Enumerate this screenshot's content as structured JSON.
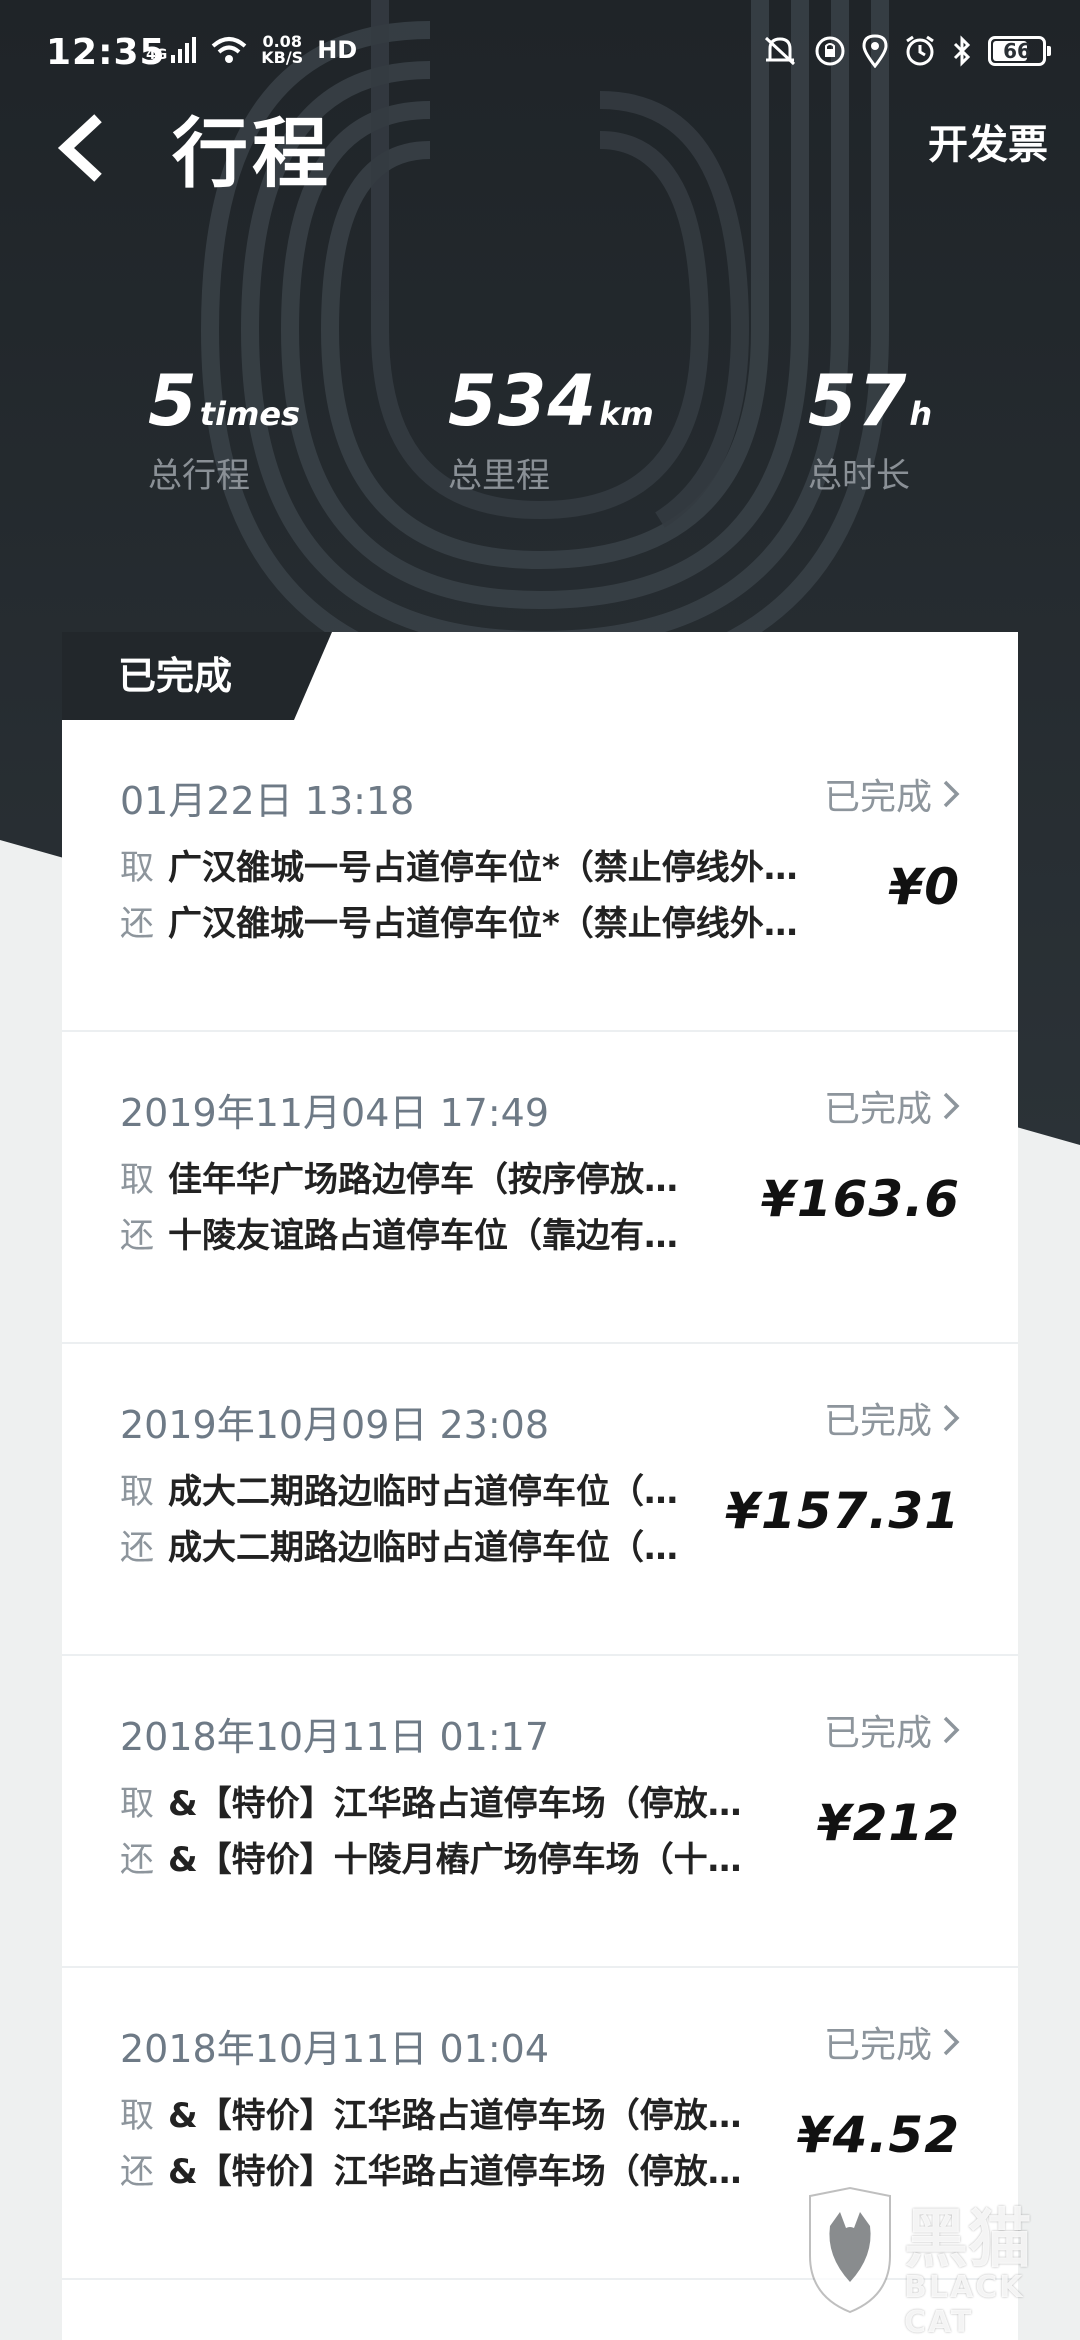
{
  "status_bar": {
    "time": "12:35",
    "network": "4G",
    "net_speed_value": "0.08",
    "net_speed_unit": "KB/S",
    "hd": "HD",
    "battery": "66"
  },
  "nav": {
    "title": "行程",
    "invoice_label": "开发票"
  },
  "stats": [
    {
      "value": "5",
      "unit": "times",
      "label": "总行程"
    },
    {
      "value": "534",
      "unit": "km",
      "label": "总里程"
    },
    {
      "value": "57",
      "unit": "h",
      "label": "总时长"
    }
  ],
  "list": {
    "tab_label": "已完成",
    "pickup_tag": "取",
    "return_tag": "还",
    "trips": [
      {
        "datetime": "01月22日 13:18",
        "status": "已完成",
        "pickup": "广汉雒城一号占道停车位*（禁止停线外…",
        "return": "广汉雒城一号占道停车位*（禁止停线外…",
        "price": "¥0"
      },
      {
        "datetime": "2019年11月04日 17:49",
        "status": "已完成",
        "pickup": "佳年华广场路边停车（按序停放…",
        "return": "十陵友谊路占道停车位（靠边有…",
        "price": "¥163.6"
      },
      {
        "datetime": "2019年10月09日 23:08",
        "status": "已完成",
        "pickup": "成大二期路边临时占道停车位（…",
        "return": "成大二期路边临时占道停车位（…",
        "price": "¥157.31"
      },
      {
        "datetime": "2018年10月11日 01:17",
        "status": "已完成",
        "pickup": "&【特价】江华路占道停车场（停放…",
        "return": "&【特价】十陵月樁广场停车场（十…",
        "price": "¥212"
      },
      {
        "datetime": "2018年10月11日 01:04",
        "status": "已完成",
        "pickup": "&【特价】江华路占道停车场（停放…",
        "return": "&【特价】江华路占道停车场（停放…",
        "price": "¥4.52"
      }
    ]
  },
  "watermark": {
    "text": "黑猫",
    "sub": "BLACK CAT"
  },
  "colors": {
    "header_bg": "#252b30",
    "accent_dark": "#1f2326",
    "muted_text": "#8d959c"
  }
}
